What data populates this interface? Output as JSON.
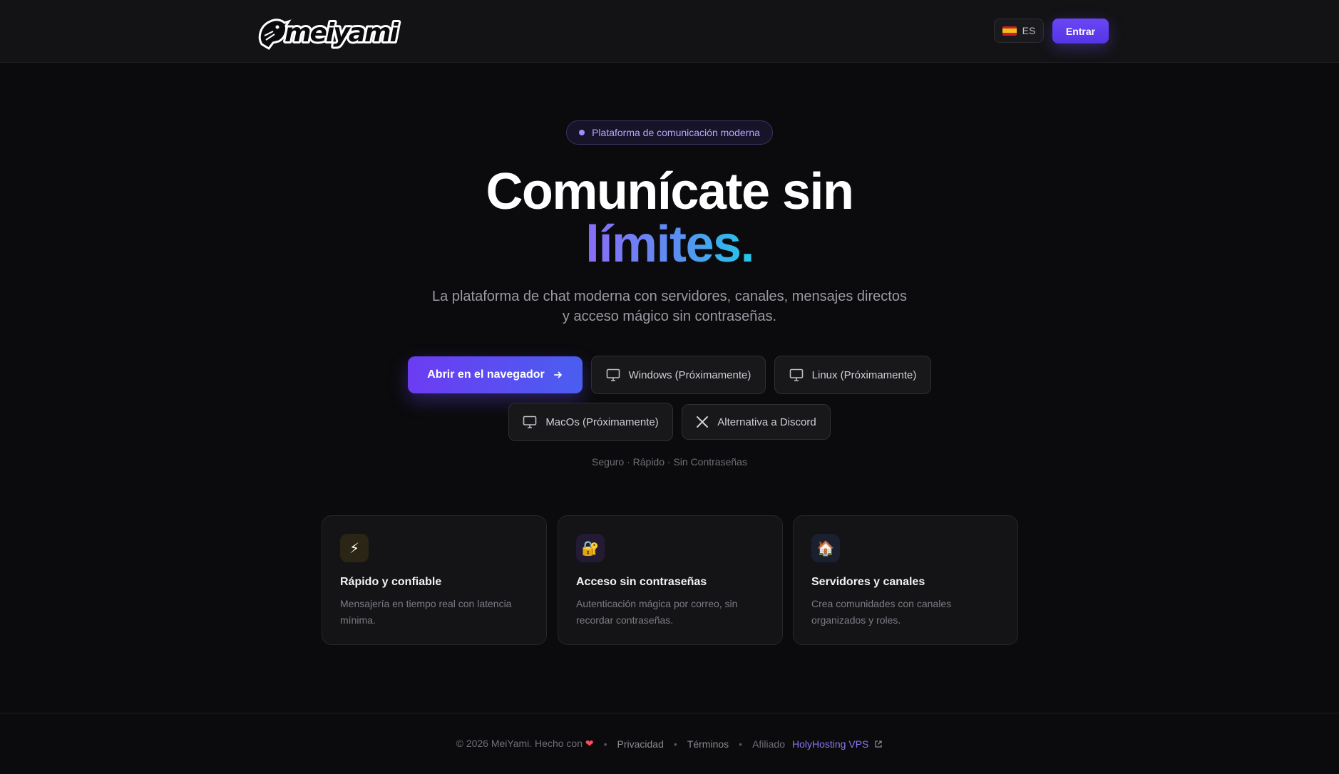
{
  "header": {
    "logo_text": "meiyami",
    "language": {
      "code": "ES",
      "flag_icon": "spain-flag-icon"
    },
    "login_label": "Entrar"
  },
  "hero": {
    "pill_label": "Plataforma de comunicación moderna",
    "title_line1": "Comunícate sin",
    "title_line2": "límites.",
    "subtitle_line1": "La plataforma de chat moderna con servidores, canales, mensajes directos",
    "subtitle_line2": "y acceso mágico sin contraseñas.",
    "buttons": [
      {
        "label": "Abrir en el navegador",
        "icon": "arrow-right-icon"
      },
      {
        "label": "Windows (Próximamente)",
        "icon": "monitor-icon"
      },
      {
        "label": "Linux (Próximamente)",
        "icon": "monitor-icon"
      },
      {
        "label": "MacOs (Próximamente)",
        "icon": "monitor-icon"
      },
      {
        "label": "Alternativa a Discord",
        "icon": "x-logo-icon"
      }
    ],
    "tagline": "Seguro · Rápido · Sin Contraseñas"
  },
  "features": [
    {
      "icon": "⚡",
      "icon_name": "lightning-icon",
      "title": "Rápido y confiable",
      "desc": "Mensajería en tiempo real con latencia mínima."
    },
    {
      "icon": "🔐",
      "icon_name": "lock-key-icon",
      "title": "Acceso sin contraseñas",
      "desc": "Autenticación mágica por correo, sin recordar contraseñas."
    },
    {
      "icon": "🏠",
      "icon_name": "house-icon",
      "title": "Servidores y canales",
      "desc": "Crea comunidades con canales organizados y roles."
    }
  ],
  "footer": {
    "copyright": "© 2026 MeiYami. Hecho con",
    "heart": "❤",
    "privacy": "Privacidad",
    "terms": "Términos",
    "affiliate_label": "Afiliado",
    "affiliate_link": "HolyHosting VPS"
  },
  "colors": {
    "background": "#0b0b0d",
    "accent": "#6a46f5",
    "gradient_start": "#8b6cf6",
    "gradient_end": "#22c9e6"
  }
}
